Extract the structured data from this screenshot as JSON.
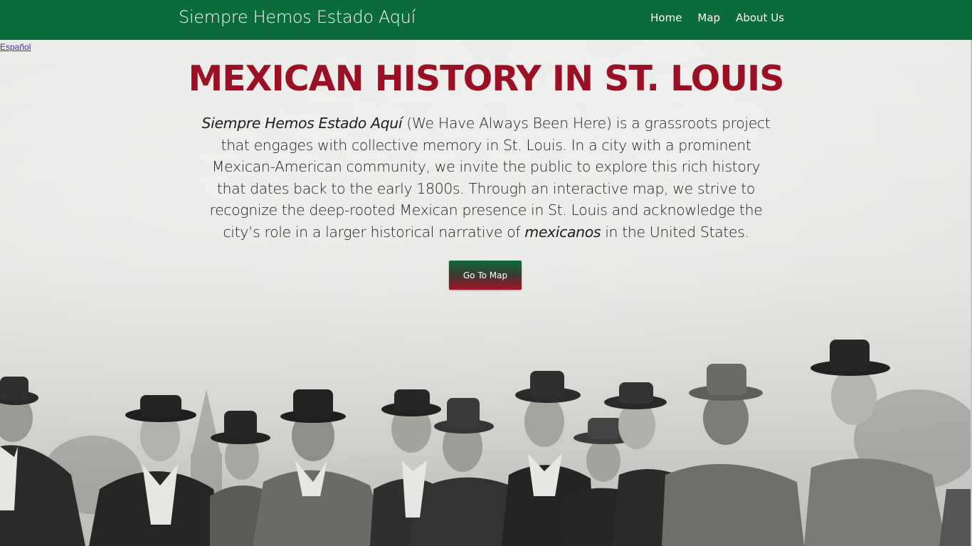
{
  "navbar": {
    "brand": "Siempre Hemos Estado Aquí",
    "links": [
      {
        "label": "Home"
      },
      {
        "label": "Map"
      },
      {
        "label": "About Us"
      }
    ]
  },
  "language_link": "Español",
  "hero": {
    "title": "MEXICAN HISTORY IN ST. LOUIS",
    "intro_italic": "Siempre Hemos Estado Aquí",
    "intro_part1": " (We Have Always Been Here) is a grassroots project that engages with collective memory in St. Louis. In a city with a prominent Mexican-American community, we invite the public to explore this rich history that dates back to the early 1800s. Through an interactive map, we strive to recognize the deep-rooted Mexican presence in St. Louis and acknowledge the city’s role in a larger historical narrative of ",
    "intro_italic2": "mexicanos",
    "intro_part2": " in the United States.",
    "button_label": "Go To Map"
  },
  "colors": {
    "navbar_bg": "#0b6b3a",
    "title": "#9b1024",
    "button_top": "#0d6b3b",
    "button_bottom": "#a3122a"
  }
}
